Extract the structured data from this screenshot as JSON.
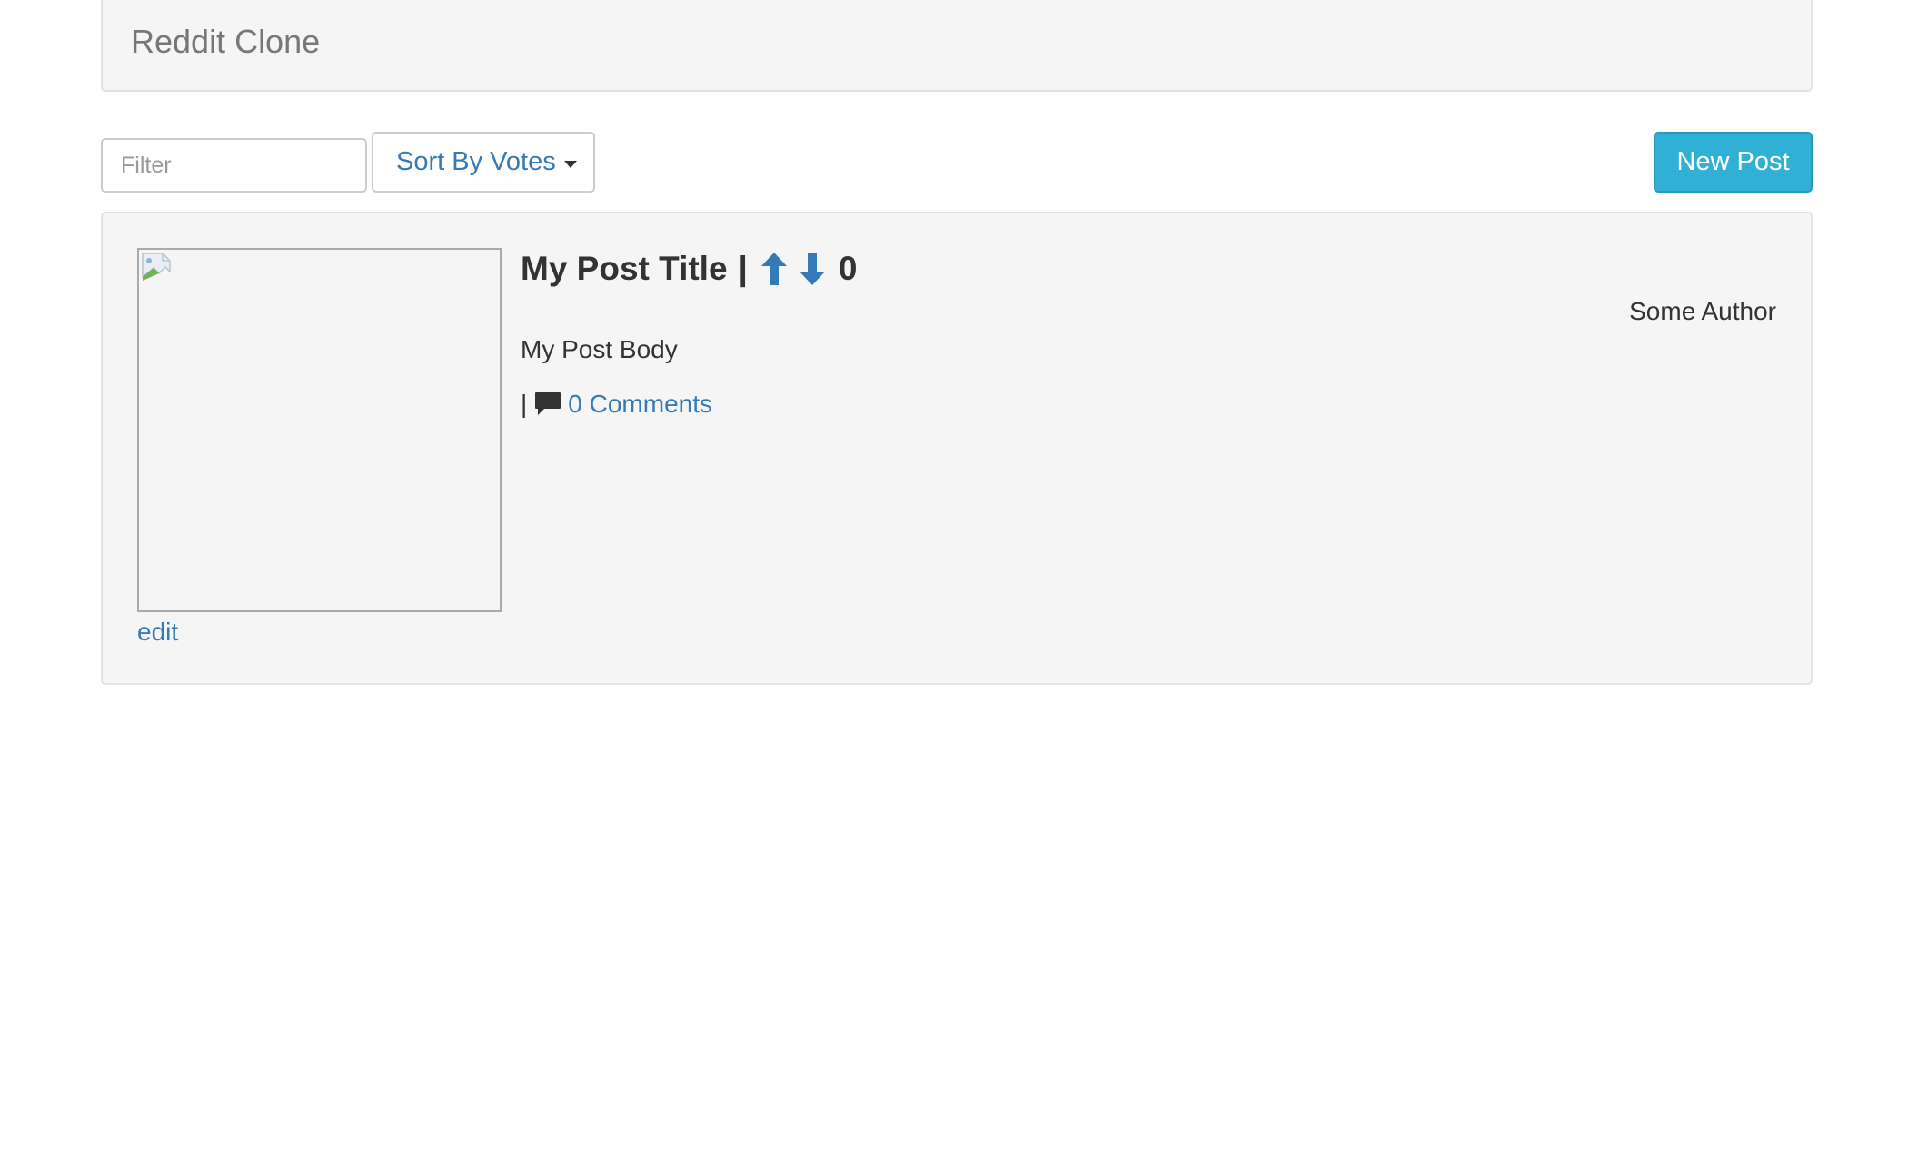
{
  "navbar": {
    "brand": "Reddit Clone"
  },
  "toolbar": {
    "filter_placeholder": "Filter",
    "sort_label": "Sort By Votes",
    "new_post_label": "New Post"
  },
  "post": {
    "title": "My Post Title",
    "separator": "|",
    "score": "0",
    "author": "Some Author",
    "body": "My Post Body",
    "meta_separator": "|",
    "comments_label": "0 Comments",
    "edit_label": "edit"
  },
  "colors": {
    "link": "#337ab7",
    "info_button": "#31b0d5",
    "panel_bg": "#f5f5f5"
  },
  "icons": {
    "upvote": "arrow-up-icon",
    "downvote": "arrow-down-icon",
    "comment": "comment-icon",
    "sort_caret": "caret-down-icon",
    "thumbnail": "broken-image-icon"
  }
}
